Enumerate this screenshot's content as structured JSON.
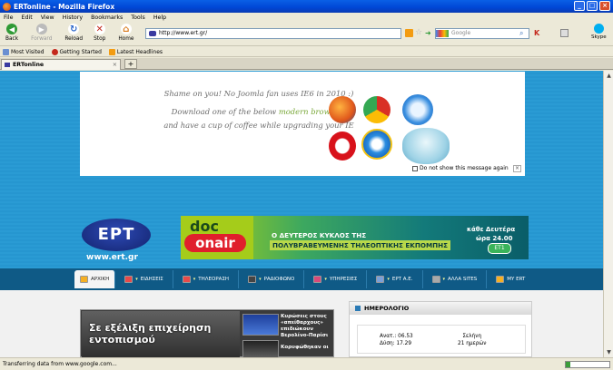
{
  "window": {
    "title": "ERTonline - Mozilla Firefox",
    "min": "_",
    "max": "□",
    "close": "×"
  },
  "menu": [
    "File",
    "Edit",
    "View",
    "History",
    "Bookmarks",
    "Tools",
    "Help"
  ],
  "toolbar": {
    "back": "Back",
    "forward": "Forward",
    "reload": "Reload",
    "stop": "Stop",
    "home": "Home"
  },
  "address": {
    "url": "http://www.ert.gr/"
  },
  "search": {
    "placeholder": "Google"
  },
  "skype": {
    "label": "Skype"
  },
  "bookmarks": [
    "Most Visited",
    "Getting Started",
    "Latest Headlines"
  ],
  "tabs": [
    {
      "label": "ERTonline"
    }
  ],
  "ie6": {
    "line1": "Shame on you! No Joomla fan uses IE6 in 2010 :)",
    "line2a": "Download one of the below ",
    "line2b": "modern browsers",
    "line3": "and have a cup of coffee while upgrading your IE",
    "dont_show": "Do not show this message again"
  },
  "logo": {
    "text": "ΕΡΤ",
    "site": "www.ert.gr"
  },
  "banner": {
    "doc": "doc",
    "onair": "onair",
    "line1": "Ο ΔΕΥΤΕΡΟΣ ΚΥΚΛΟΣ ΤΗΣ",
    "line2a": "ΠΟΛΥΒΡΑΒΕΥΜΕΝΗΣ",
    "line2b": " ΤΗΛΕΟΠΤΙΚΗΣ ΕΚΠΟΜΠΗΣ",
    "day": "κάθε Δευτέρα",
    "time": "ώρα 24.00",
    "channel": "ΕΤ1"
  },
  "nav": [
    "ΑΡΧΙΚΗ",
    "ΕΙΔΗΣΕΙΣ",
    "ΤΗΛΕΟΡΑΣΗ",
    "ΡΑΔΙΟΦΩΝΟ",
    "ΥΠΗΡΕΣΙΕΣ",
    "ΕΡΤ Α.Ε.",
    "ΑΛΛΑ SITES",
    "MY ERT"
  ],
  "news": {
    "headline": "Σε εξέλιξη επιχείρηση εντοπισμού",
    "item1": "Κυρώσεις στους «απείθαρχους» επιδιώκουν Βερολίνο-Παρίσι",
    "item2": "Κορυφώθηκαν οι"
  },
  "diary": {
    "title": "ΗΜΕΡΟΛΟΓΙΟ",
    "sunrise": "Ανατ.: 06.53",
    "sunset": "Δύση: 17.29",
    "moon": "Σελήνη",
    "moon_age": "21 ημερών"
  },
  "status": {
    "text": "Transferring data from www.google.com...",
    "progress": 0.1
  },
  "colors": {
    "titlebar": "#0046d5",
    "site_blue": "#2a9bd4",
    "nav_dark": "#0f5a86"
  }
}
